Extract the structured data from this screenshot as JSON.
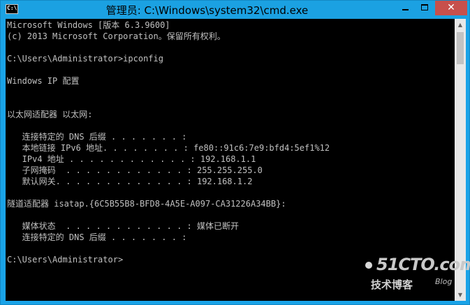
{
  "window": {
    "title": "管理员: C:\\Windows\\system32\\cmd.exe",
    "icon_label": "C:\\",
    "controls": {
      "minimize_icon": "minimize-icon",
      "maximize_icon": "maximize-icon",
      "close_label": "✕"
    }
  },
  "console": {
    "lines": [
      "Microsoft Windows [版本 6.3.9600]",
      "(c) 2013 Microsoft Corporation。保留所有权利。",
      "",
      "C:\\Users\\Administrator>ipconfig",
      "",
      "Windows IP 配置",
      "",
      "",
      "以太网适配器 以太网:",
      "",
      "   连接特定的 DNS 后缀 . . . . . . . :",
      "   本地链接 IPv6 地址. . . . . . . . : fe80::91c6:7e9:bfd4:5ef1%12",
      "   IPv4 地址 . . . . . . . . . . . . : 192.168.1.1",
      "   子网掩码  . . . . . . . . . . . . : 255.255.255.0",
      "   默认网关. . . . . . . . . . . . . : 192.168.1.2",
      "",
      "隧道适配器 isatap.{6C5B55B8-BFD8-4A5E-A097-CA31226A34BB}:",
      "",
      "   媒体状态  . . . . . . . . . . . . : 媒体已断开",
      "   连接特定的 DNS 后缀 . . . . . . . :",
      "",
      "C:\\Users\\Administrator>"
    ]
  },
  "scrollbar": {
    "up_icon": "scroll-up-arrow-icon",
    "down_icon": "scroll-down-arrow-icon"
  },
  "watermark": {
    "logo": "51CTO.com",
    "subtitle": "技术博客",
    "blog": "Blog"
  }
}
